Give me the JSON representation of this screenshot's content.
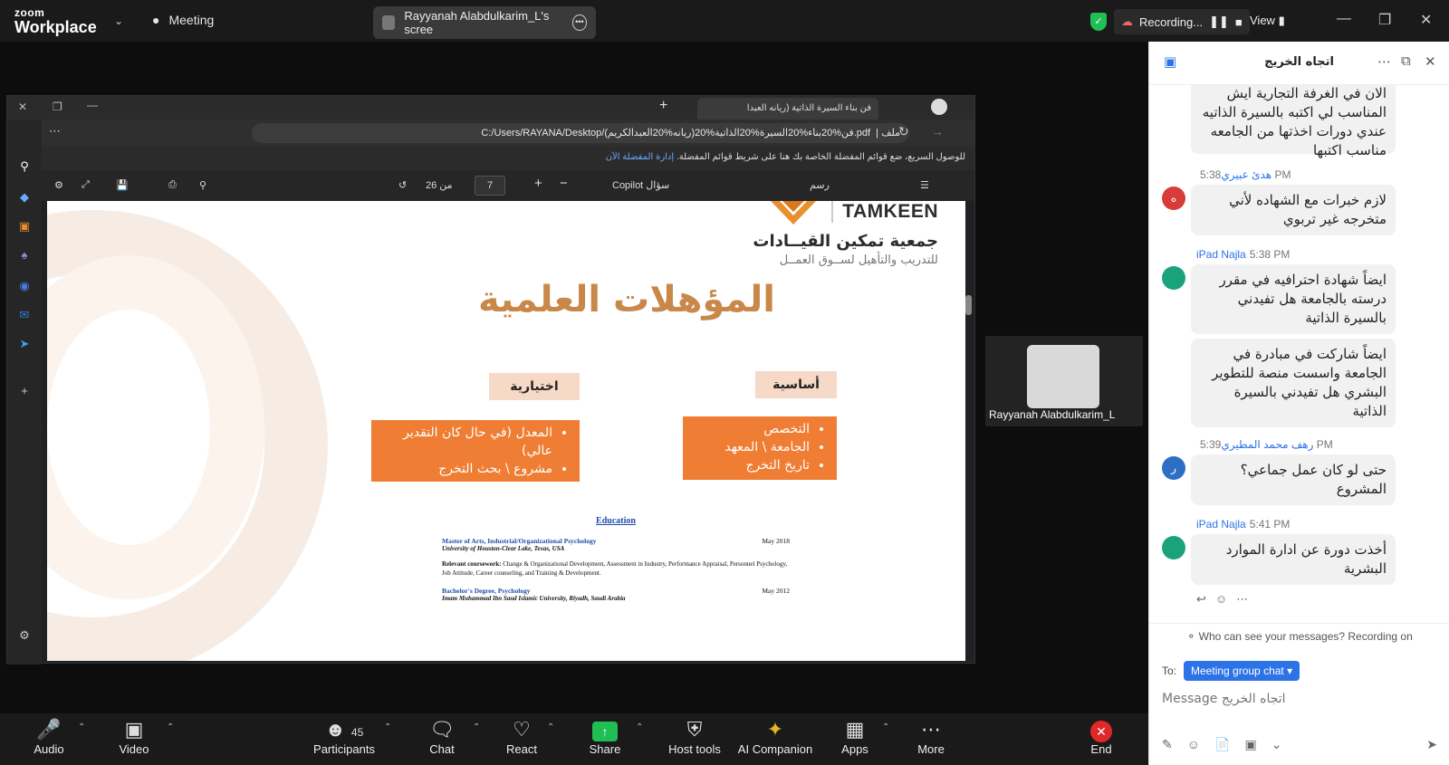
{
  "app": {
    "brand_line1": "zoom",
    "brand_line2": "Workplace",
    "meeting_label": "Meeting"
  },
  "share_pill": {
    "label": "Rayyanah Alabdulkarim_L's scree"
  },
  "recording": {
    "label": "Recording...",
    "view_label": "View"
  },
  "browser": {
    "tab_title": "فن بناء السيرة الذاتية (ريانه العبدا",
    "url_prefix": "ملف",
    "url": "C:/Users/RAYANA/Desktop/فن%20بناء%20السيرة%20الذاتية%20(ريانه%20العبدالكريم).pdf",
    "favbar_text": "للوصول السريع، ضع قوائم المفضلة الخاصة بك هنا على شريط قوائم المفضلة.",
    "favbar_link": "إدارة المفضلة الآن",
    "pdf_page": "7",
    "pdf_of": "من 26",
    "pdf_copilot": "Copilot سؤال",
    "pdf_draw": "رسم"
  },
  "slide": {
    "brand_en": "TAMKEEN",
    "brand_ar": "جمعية تمكين القيــادات",
    "brand_sub": "للتدريب والتأهيل لســوق العمــل",
    "title": "المؤهلات العلمية",
    "chip_optional": "اختيارية",
    "chip_basic": "أساسية",
    "optional_items": [
      "المعدل (في حال كان التقدير عالي)",
      "مشروع \\ بحث التخرج"
    ],
    "basic_items": [
      "التخصص",
      "الجامعة \\ المعهد",
      "تاريخ التخرج"
    ],
    "cv": {
      "heading": "Education",
      "deg1": "Master of Arts, Industrial/Organizational Psychology",
      "deg1_date": "May 2018",
      "deg1_school": "University of Houston-Clear Lake, Texas, USA",
      "coursework_label": "Relevant coursework:",
      "coursework": "Change & Organizational Development, Assessment in Industry, Performance Appraisal, Personnel Psychology, Job Attitude, Career counseling, and Training & Development.",
      "deg2": "Bachelor's Degree, Psychology",
      "deg2_date": "May 2012",
      "deg2_school": "Imam Muhammad Ibn Saud Islamic University, Riyadh, Saudi Arabia"
    }
  },
  "participant": {
    "name": "Rayyanah Alabdulkarim_L"
  },
  "chat": {
    "title": "اتجاه الخريج",
    "messages": [
      {
        "text": "الان في الغرفة التجارية ايش المناسب لي اكتبه بالسيرة الذاتيه عندي دورات اخذتها من الجامعه مناسب اكتبها"
      },
      {
        "sender": "هدئ عبيري",
        "time": "5:38 PM",
        "initial": "ه",
        "color": "#d93b3b",
        "text": "لازم خبرات مع الشهاده لأني متخرجه غير تربوي"
      },
      {
        "sender": "iPad Najla",
        "time": "5:38 PM",
        "initial": "",
        "color": "#1aa37a",
        "text": "ايضاً شهادة احترافيه في مقرر درسته بالجامعة هل تفيدني بالسيرة الذاتية"
      },
      {
        "text": "ايضاً شاركت في مبادرة في الجامعة واسست منصة للتطوير البشري هل تفيدني بالسيرة الذاتية"
      },
      {
        "sender": "رهف محمد المطيري",
        "time": "5:39 PM",
        "initial": "ر",
        "color": "#2d6fc4",
        "text": "حتى لو كان عمل جماعي؟ المشروع"
      },
      {
        "sender": "iPad Najla",
        "time": "5:41 PM",
        "initial": "",
        "color": "#1aa37a",
        "text": "أخذت دورة عن ادارة الموارد البشرية"
      }
    ],
    "privacy_note": "Who can see your messages? Recording on",
    "to_label": "To:",
    "to_value": "Meeting group chat",
    "input_placeholder": "Message اتجاه الخريج"
  },
  "controls": {
    "audio": "Audio",
    "video": "Video",
    "participants": "Participants",
    "participants_count": "45",
    "chat": "Chat",
    "react": "React",
    "share": "Share",
    "host_tools": "Host tools",
    "ai_companion": "AI Companion",
    "apps": "Apps",
    "more": "More",
    "end": "End"
  },
  "colors": {
    "share_green": "#1fbf53",
    "end_red": "#e02828",
    "accent_blue": "#2d73e8",
    "slide_orange": "#ef7d33",
    "title_gold": "#c9884a"
  }
}
